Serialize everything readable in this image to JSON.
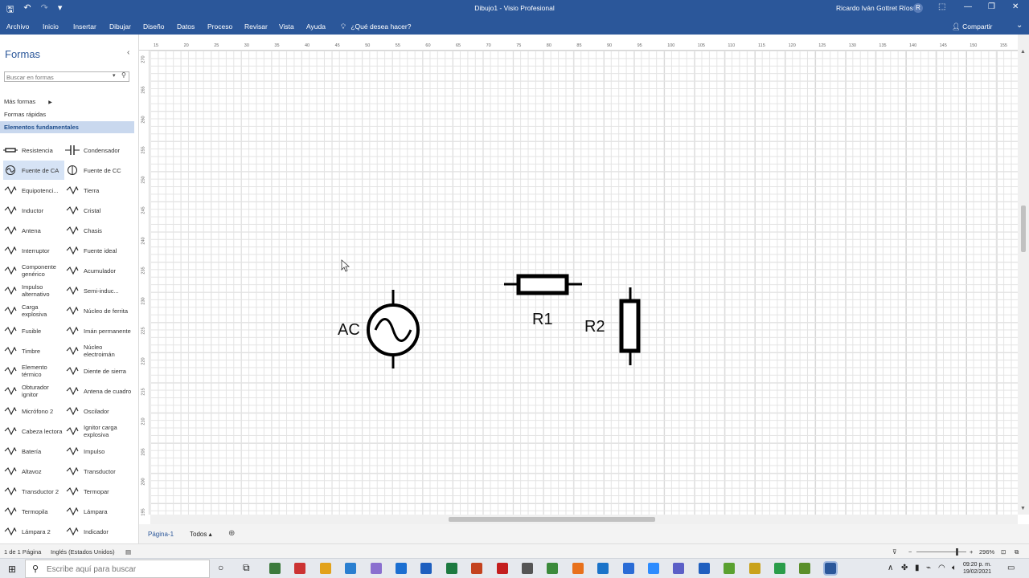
{
  "window": {
    "title": "Dibujo1 - Visio Profesional",
    "user": "Ricardo Iván Gottret Ríos",
    "user_initial": "R"
  },
  "quick_access": [
    "🖫",
    "↶",
    "↷",
    "▾"
  ],
  "window_controls": [
    "⬚",
    "—",
    "❐",
    "✕"
  ],
  "menu": {
    "items": [
      "Archivo",
      "Inicio",
      "Insertar",
      "Dibujar",
      "Diseño",
      "Datos",
      "Proceso",
      "Revisar",
      "Vista",
      "Ayuda"
    ],
    "tell_me": "¿Qué desea hacer?",
    "share": "Compartir"
  },
  "shapes_panel": {
    "title": "Formas",
    "search_placeholder": "Buscar en formas",
    "more_shapes": "Más formas",
    "quick_shapes": "Formas rápidas",
    "stencil": "Elementos fundamentales",
    "items": [
      {
        "label": "Resistencia",
        "icon": "resistor-icon"
      },
      {
        "label": "Condensador",
        "icon": "capacitor-icon"
      },
      {
        "label": "Fuente de CA",
        "icon": "ac-source-icon",
        "selected": true
      },
      {
        "label": "Fuente de CC",
        "icon": "dc-source-icon"
      },
      {
        "label": "Equipotenci...",
        "icon": "equipotential-icon"
      },
      {
        "label": "Tierra",
        "icon": "ground-icon"
      },
      {
        "label": "Inductor",
        "icon": "inductor-icon"
      },
      {
        "label": "Cristal",
        "icon": "crystal-icon"
      },
      {
        "label": "Antena",
        "icon": "antenna-icon"
      },
      {
        "label": "Chasis",
        "icon": "chassis-icon"
      },
      {
        "label": "Interruptor",
        "icon": "switch-icon"
      },
      {
        "label": "Fuente ideal",
        "icon": "ideal-source-icon"
      },
      {
        "label": "Componente genérico",
        "icon": "generic-component-icon"
      },
      {
        "label": "Acumulador",
        "icon": "accumulator-icon"
      },
      {
        "label": "Impulso alternativo",
        "icon": "alternating-pulse-icon"
      },
      {
        "label": "Semi-induc...",
        "icon": "semi-inductor-icon"
      },
      {
        "label": "Carga explosiva",
        "icon": "explosive-load-icon"
      },
      {
        "label": "Núcleo de ferrita",
        "icon": "ferrite-core-icon"
      },
      {
        "label": "Fusible",
        "icon": "fuse-icon"
      },
      {
        "label": "Imán permanente",
        "icon": "permanent-magnet-icon"
      },
      {
        "label": "Timbre",
        "icon": "bell-icon"
      },
      {
        "label": "Núcleo electroimán",
        "icon": "electromagnet-core-icon"
      },
      {
        "label": "Elemento térmico",
        "icon": "thermal-element-icon"
      },
      {
        "label": "Diente de sierra",
        "icon": "sawtooth-icon"
      },
      {
        "label": "Obturador ignitor",
        "icon": "ignitor-icon"
      },
      {
        "label": "Antena de cuadro",
        "icon": "loop-antenna-icon"
      },
      {
        "label": "Micrófono 2",
        "icon": "microphone-icon"
      },
      {
        "label": "Oscilador",
        "icon": "oscillator-icon"
      },
      {
        "label": "Cabeza lectora",
        "icon": "read-head-icon"
      },
      {
        "label": "Ignitor carga explosiva",
        "icon": "explosive-ignitor-icon"
      },
      {
        "label": "Batería",
        "icon": "battery-icon"
      },
      {
        "label": "Impulso",
        "icon": "pulse-icon"
      },
      {
        "label": "Altavoz",
        "icon": "speaker-icon"
      },
      {
        "label": "Transductor",
        "icon": "transducer-icon"
      },
      {
        "label": "Transductor 2",
        "icon": "transducer-2-icon"
      },
      {
        "label": "Termopar",
        "icon": "thermocouple-icon"
      },
      {
        "label": "Termopila",
        "icon": "thermopile-icon"
      },
      {
        "label": "Lámpara",
        "icon": "lamp-icon"
      },
      {
        "label": "Lámpara 2",
        "icon": "lamp-2-icon"
      },
      {
        "label": "Indicador",
        "icon": "indicator-icon"
      }
    ]
  },
  "ruler": {
    "top": [
      "15",
      "20",
      "25",
      "30",
      "35",
      "40",
      "45",
      "50",
      "55",
      "60",
      "65",
      "70",
      "75",
      "80",
      "85",
      "90",
      "95",
      "100",
      "105",
      "110",
      "115",
      "120",
      "125",
      "130",
      "135",
      "140",
      "145",
      "150",
      "155"
    ],
    "left": [
      "270",
      "265",
      "260",
      "255",
      "250",
      "245",
      "240",
      "235",
      "230",
      "225",
      "220",
      "215",
      "210",
      "205",
      "200",
      "195"
    ]
  },
  "drawing": {
    "ac_label": "AC",
    "r1_label": "R1",
    "r2_label": "R2"
  },
  "pages": {
    "current": "Página-1",
    "all": "Todos ▴",
    "add": "⊕"
  },
  "status": {
    "page_info": "1 de 1 Página",
    "language": "Inglés (Estados Unidos)",
    "zoom": "296%"
  },
  "taskbar": {
    "search_placeholder": "Escribe aquí para buscar",
    "time": "09:20 p. m.",
    "date": "19/02/2021"
  }
}
